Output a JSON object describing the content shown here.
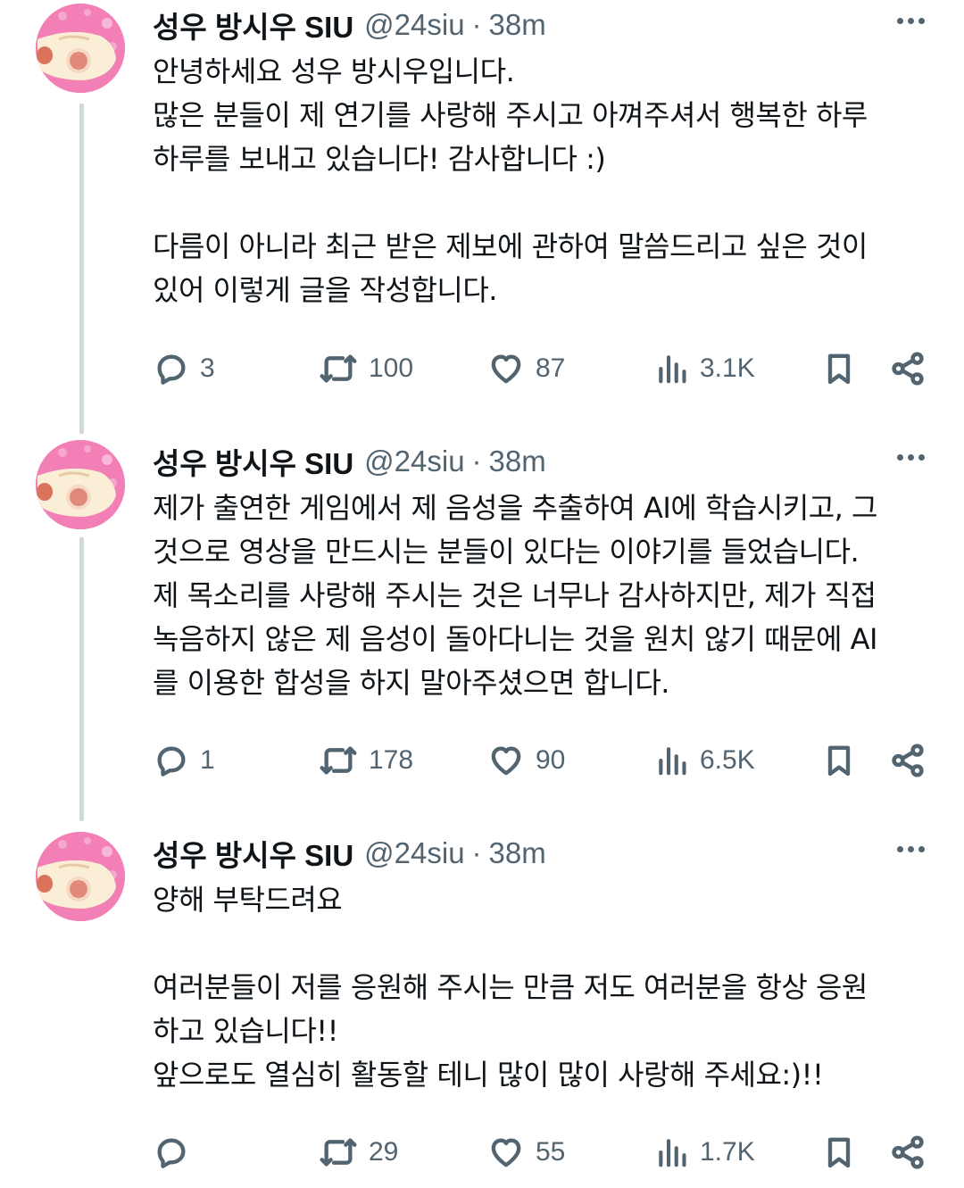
{
  "tweets": [
    {
      "author": {
        "name": "성우 방시우 SIU",
        "handle": "@24siu",
        "separator": "·",
        "time": "38m"
      },
      "lines": [
        "안녕하세요 성우 방시우입니다.",
        "많은 분들이 제 연기를 사랑해 주시고 아껴주셔서 행복한 하루",
        "하루를 보내고 있습니다! 감사합니다 :)",
        "",
        "다름이 아니라 최근 받은 제보에 관하여 말씀드리고 싶은 것이",
        "있어 이렇게 글을 작성합니다."
      ],
      "stats": {
        "replies": "3",
        "reposts": "100",
        "likes": "87",
        "views": "3.1K"
      }
    },
    {
      "author": {
        "name": "성우 방시우 SIU",
        "handle": "@24siu",
        "separator": "·",
        "time": "38m"
      },
      "lines": [
        "제가 출연한 게임에서 제 음성을 추출하여 AI에 학습시키고, 그",
        "것으로 영상을 만드시는 분들이 있다는 이야기를 들었습니다.",
        "제 목소리를 사랑해 주시는 것은 너무나 감사하지만, 제가 직접",
        "녹음하지 않은 제 음성이 돌아다니는 것을 원치 않기 때문에 AI",
        "를 이용한 합성을 하지 말아주셨으면 합니다."
      ],
      "stats": {
        "replies": "1",
        "reposts": "178",
        "likes": "90",
        "views": "6.5K"
      }
    },
    {
      "author": {
        "name": "성우 방시우 SIU",
        "handle": "@24siu",
        "separator": "·",
        "time": "38m"
      },
      "lines": [
        "양해 부탁드려요",
        "",
        "여러분들이 저를 응원해 주시는 만큼 저도 여러분을 항상 응원",
        "하고 있습니다!!",
        "앞으로도 열심히 활동할 테니 많이 많이 사랑해 주세요:)!!"
      ],
      "stats": {
        "replies": "",
        "reposts": "29",
        "likes": "55",
        "views": "1.7K"
      }
    }
  ],
  "icons": {
    "more": "more-horizontal-icon",
    "reply": "reply-bubble-icon",
    "repost": "repost-arrows-icon",
    "like": "heart-icon",
    "views": "views-bar-chart-icon",
    "bookmark": "bookmark-icon",
    "share": "share-icon"
  },
  "colors": {
    "text": "#0f1419",
    "secondary": "#536471",
    "thread_line": "#cfd9de",
    "avatar_pink": "#f27fb6"
  }
}
